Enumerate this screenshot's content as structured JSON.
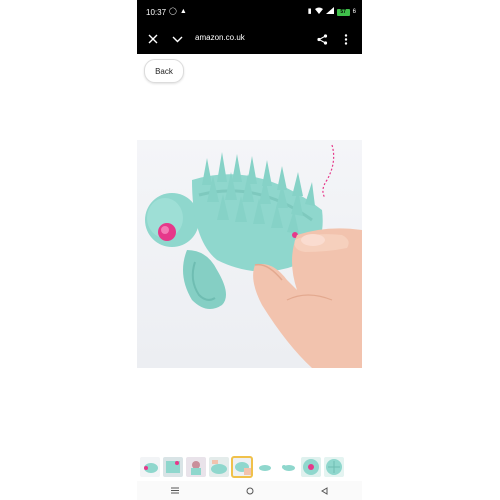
{
  "status_bar": {
    "time": "10:37",
    "battery_level": "57",
    "battery_extra": "6"
  },
  "browser": {
    "url": "amazon.co.uk"
  },
  "page": {
    "back_label": "Back"
  },
  "colors": {
    "brush": "#8fd7cd",
    "accent_pink": "#e6388a",
    "thumb_selected": "#f0c14b"
  },
  "icons": {
    "close": "close-icon",
    "chevron": "chevron-down-icon",
    "share": "share-icon",
    "menu": "more-vert-icon"
  },
  "thumbnails": {
    "count_visible": 9,
    "selected_index": 4
  }
}
